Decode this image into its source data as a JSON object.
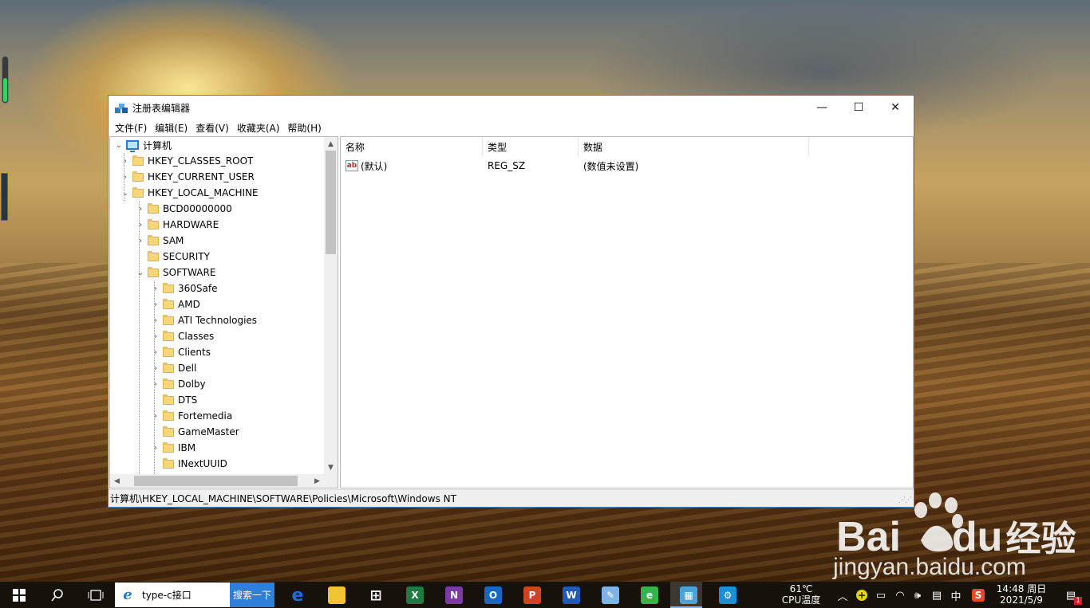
{
  "window": {
    "title": "注册表编辑器",
    "menu": [
      "文件(F)",
      "编辑(E)",
      "查看(V)",
      "收藏夹(A)",
      "帮助(H)"
    ]
  },
  "tree": {
    "root": "计算机",
    "items": [
      {
        "label": "HKEY_CLASSES_ROOT",
        "level": 1,
        "chevron": "right"
      },
      {
        "label": "HKEY_CURRENT_USER",
        "level": 1,
        "chevron": "right"
      },
      {
        "label": "HKEY_LOCAL_MACHINE",
        "level": 1,
        "chevron": "down"
      },
      {
        "label": "BCD00000000",
        "level": 2,
        "chevron": "right"
      },
      {
        "label": "HARDWARE",
        "level": 2,
        "chevron": "right"
      },
      {
        "label": "SAM",
        "level": 2,
        "chevron": "right"
      },
      {
        "label": "SECURITY",
        "level": 2,
        "chevron": "none"
      },
      {
        "label": "SOFTWARE",
        "level": 2,
        "chevron": "down"
      },
      {
        "label": "360Safe",
        "level": 3,
        "chevron": "right"
      },
      {
        "label": "AMD",
        "level": 3,
        "chevron": "right"
      },
      {
        "label": "ATI Technologies",
        "level": 3,
        "chevron": "right"
      },
      {
        "label": "Classes",
        "level": 3,
        "chevron": "right"
      },
      {
        "label": "Clients",
        "level": 3,
        "chevron": "right"
      },
      {
        "label": "Dell",
        "level": 3,
        "chevron": "right"
      },
      {
        "label": "Dolby",
        "level": 3,
        "chevron": "right"
      },
      {
        "label": "DTS",
        "level": 3,
        "chevron": "none"
      },
      {
        "label": "Fortemedia",
        "level": 3,
        "chevron": "right"
      },
      {
        "label": "GameMaster",
        "level": 3,
        "chevron": "none"
      },
      {
        "label": "IBM",
        "level": 3,
        "chevron": "right"
      },
      {
        "label": "INextUUID",
        "level": 3,
        "chevron": "none"
      }
    ]
  },
  "list": {
    "columns": [
      "名称",
      "类型",
      "数据"
    ],
    "rows": [
      {
        "name": "(默认)",
        "type": "REG_SZ",
        "data": "(数值未设置)"
      }
    ]
  },
  "statusbar": {
    "path": "计算机\\HKEY_LOCAL_MACHINE\\SOFTWARE\\Policies\\Microsoft\\Windows NT"
  },
  "watermark": {
    "brand": "Bai",
    "brand_suffix": "du",
    "brand_cn": "经验",
    "site": "jingyan.baidu.com"
  },
  "taskbar": {
    "search_value": "type-c接口",
    "search_button": "搜索一下",
    "apps": [
      {
        "icon": "edge-icon",
        "glyph": "e",
        "color": "#1a6fd6"
      },
      {
        "icon": "file-explorer-icon",
        "glyph": "",
        "color": "#f1c232"
      },
      {
        "icon": "microsoft-store-icon",
        "glyph": "⊞",
        "color": "#ffffff"
      },
      {
        "icon": "excel-icon",
        "glyph": "X",
        "color": "#1d7a43"
      },
      {
        "icon": "onenote-icon",
        "glyph": "N",
        "color": "#7b3aa6"
      },
      {
        "icon": "outlook-icon",
        "glyph": "O",
        "color": "#1668c4"
      },
      {
        "icon": "powerpoint-icon",
        "glyph": "P",
        "color": "#d04423"
      },
      {
        "icon": "word-icon",
        "glyph": "W",
        "color": "#1f5bb5"
      },
      {
        "icon": "paint-icon",
        "glyph": "✎",
        "color": "#7fb3e6"
      },
      {
        "icon": "360-browser-icon",
        "glyph": "e",
        "color": "#36b44a"
      },
      {
        "icon": "regedit-icon",
        "glyph": "▦",
        "color": "#4ba3d8"
      },
      {
        "icon": "settings-app-icon",
        "glyph": "⚙",
        "color": "#1a8fd6"
      }
    ],
    "temperature": "61℃",
    "temperature_label": "CPU温度",
    "ime": "中",
    "time": "14:48 周日",
    "date": "2021/5/9",
    "notification_count": "1"
  }
}
